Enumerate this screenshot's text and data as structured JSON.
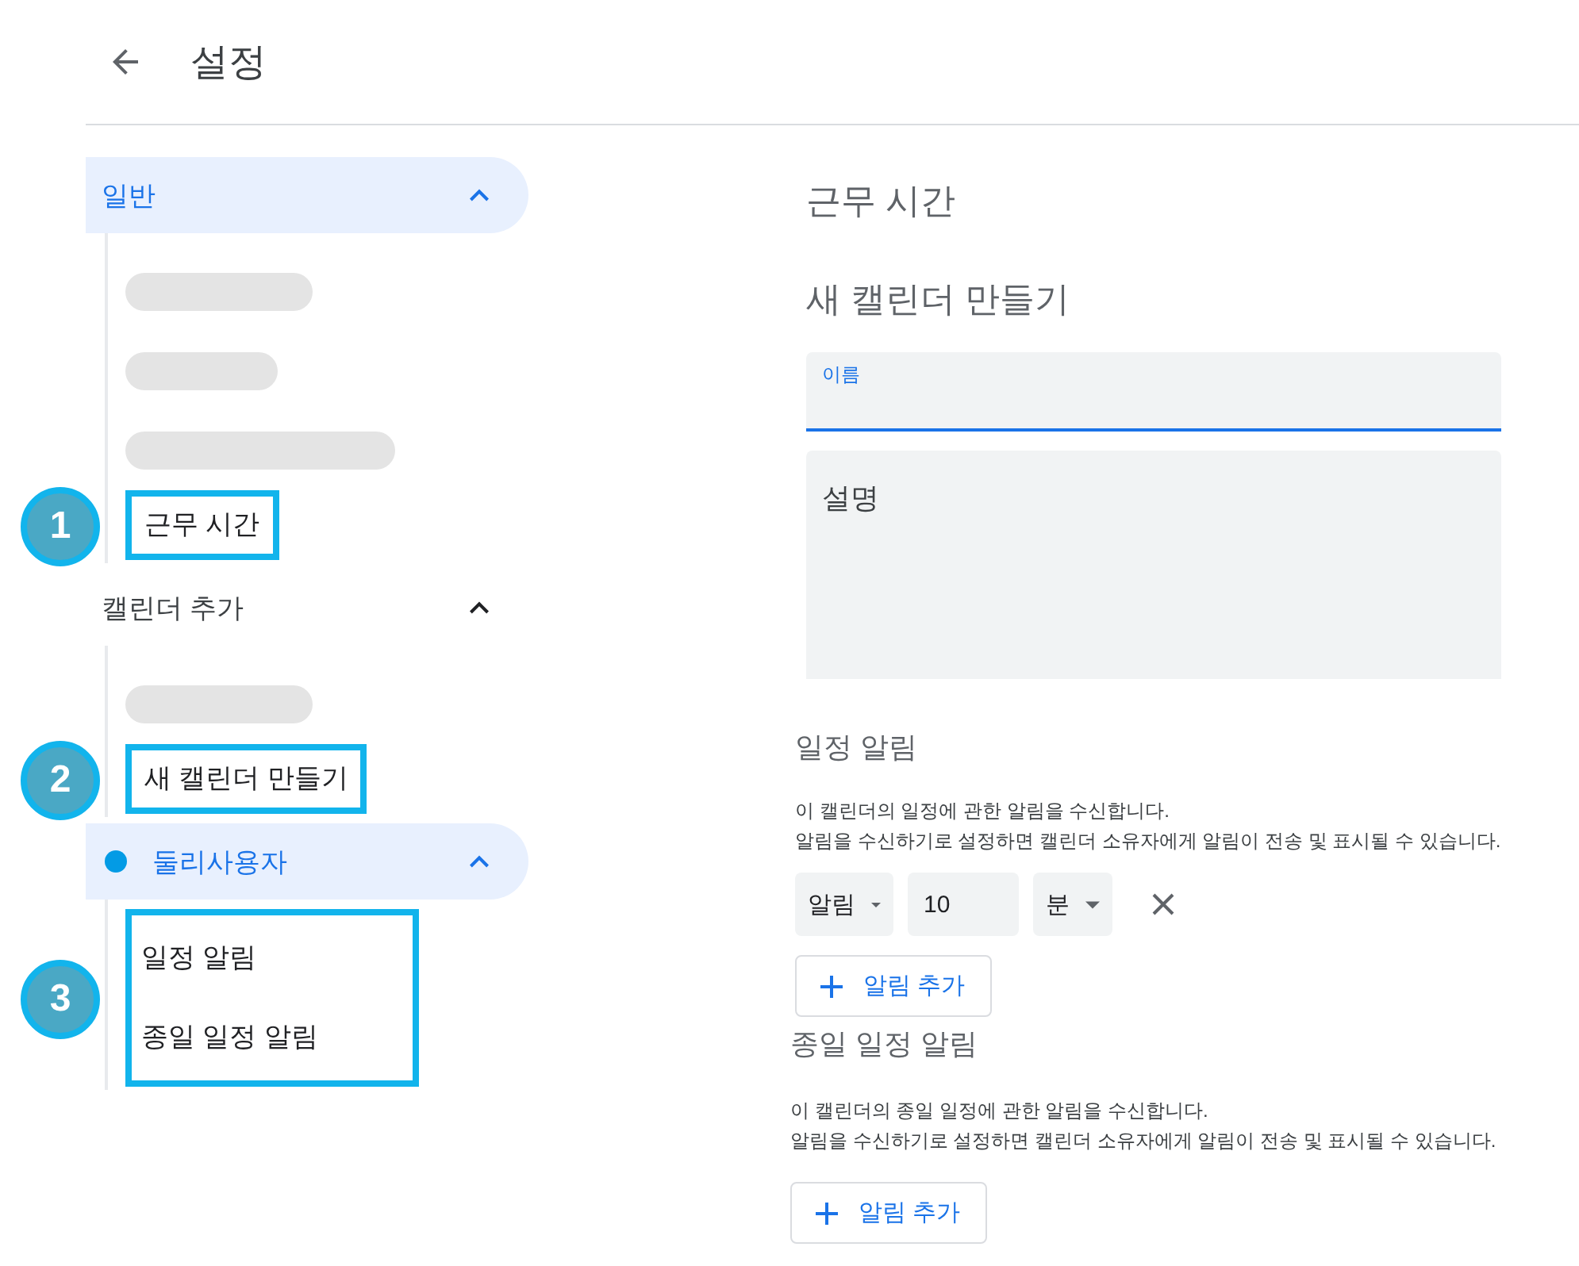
{
  "header": {
    "title": "설정"
  },
  "sidebar": {
    "sections": [
      {
        "label": "일반",
        "selected": true,
        "expanded": true,
        "callout": "1",
        "items": [
          {
            "kind": "redacted"
          },
          {
            "kind": "redacted"
          },
          {
            "kind": "redacted"
          },
          {
            "kind": "link",
            "label": "근무 시간",
            "highlighted": true
          }
        ]
      },
      {
        "label": "캘린더 추가",
        "selected": false,
        "expanded": true,
        "callout": "2",
        "items": [
          {
            "kind": "redacted"
          },
          {
            "kind": "link",
            "label": "새 캘린더 만들기",
            "highlighted": true
          }
        ]
      },
      {
        "label": "둘리사용자",
        "selected": true,
        "expanded": true,
        "color": "#039be5",
        "callout": "3",
        "items": [
          {
            "kind": "link",
            "label": "일정 알림",
            "highlighted": true
          },
          {
            "kind": "link",
            "label": "종일 일정 알림",
            "highlighted": true
          }
        ]
      }
    ]
  },
  "content": {
    "working_hours_title": "근무 시간",
    "create_calendar": {
      "title": "새 캘린더 만들기",
      "name_field": {
        "label": "이름",
        "focused": true
      },
      "description_field": {
        "placeholder": "설명"
      }
    },
    "event_notifications": {
      "title": "일정 알림",
      "description": [
        "이 캘린더의 일정에 관한 알림을 수신합니다.",
        "알림을 수신하기로 설정하면 캘린더 소유자에게 알림이 전송 및 표시될 수 있습니다."
      ],
      "rows": [
        {
          "method": "알림",
          "value": "10",
          "unit": "분"
        }
      ],
      "add_button": "알림 추가"
    },
    "all_day_notifications": {
      "title": "종일 일정 알림",
      "description": [
        "이 캘린더의 종일 일정에 관한 알림을 수신합니다.",
        "알림을 수신하기로 설정하면 캘린더 소유자에게 알림이 전송 및 표시될 수 있습니다."
      ],
      "add_button": "알림 추가"
    }
  }
}
